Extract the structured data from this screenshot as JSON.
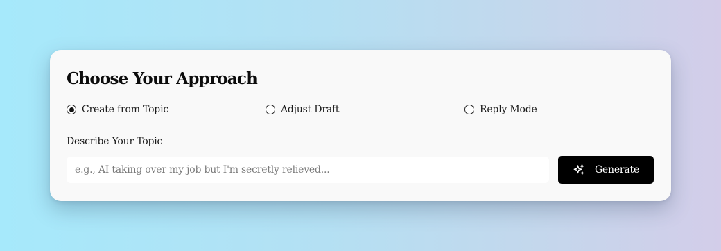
{
  "card": {
    "title": "Choose Your Approach"
  },
  "approach_options": [
    {
      "label": "Create from Topic",
      "selected": true
    },
    {
      "label": "Adjust Draft",
      "selected": false
    },
    {
      "label": "Reply Mode",
      "selected": false
    }
  ],
  "topic_field": {
    "label": "Describe Your Topic",
    "value": "",
    "placeholder": "e.g., AI taking over my job but I'm secretly relieved..."
  },
  "generate_button": {
    "label": "Generate",
    "icon": "sparkle-icon"
  },
  "colors": {
    "background_start": "#a6e9fb",
    "background_end": "#d3cde9",
    "card": "#f9f9f9",
    "button": "#000000",
    "button_text": "#ffffff"
  }
}
